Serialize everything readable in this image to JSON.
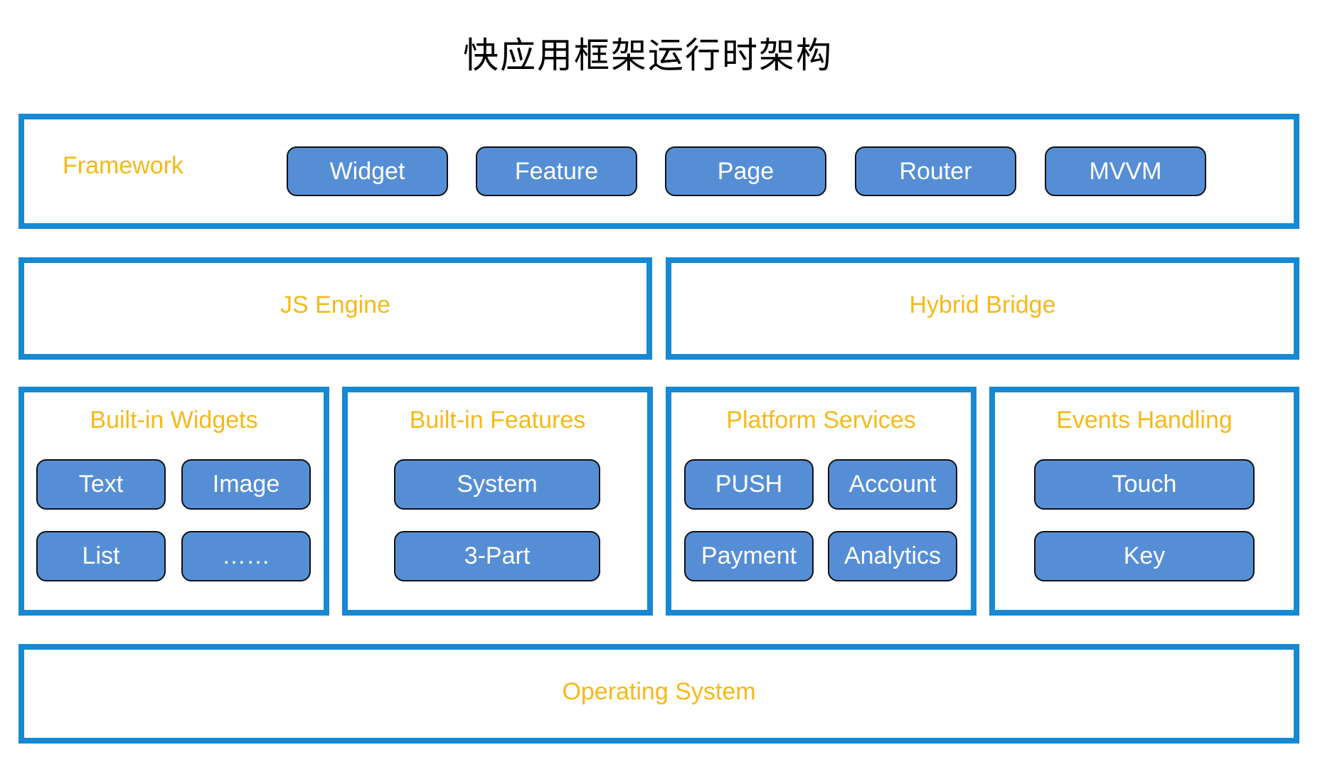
{
  "title": "快应用框架运行时架构",
  "colors": {
    "layer_border": "#1589d3",
    "layer_label": "#f5b918",
    "component_fill": "#568ed6",
    "component_border": "#111111",
    "component_text": "#ffffff",
    "title_text": "#000000"
  },
  "framework": {
    "label": "Framework",
    "components": [
      "Widget",
      "Feature",
      "Page",
      "Router",
      "MVVM"
    ]
  },
  "js_engine": {
    "label": "JS Engine"
  },
  "hybrid_bridge": {
    "label": "Hybrid Bridge"
  },
  "builtin_widgets": {
    "label": "Built-in Widgets",
    "components": [
      "Text",
      "Image",
      "List",
      "……"
    ]
  },
  "builtin_features": {
    "label": "Built-in Features",
    "components": [
      "System",
      "3-Part"
    ]
  },
  "platform_services": {
    "label": "Platform Services",
    "components": [
      "PUSH",
      "Account",
      "Payment",
      "Analytics"
    ]
  },
  "events_handling": {
    "label": "Events Handling",
    "components": [
      "Touch",
      "Key"
    ]
  },
  "operating_system": {
    "label": "Operating System"
  }
}
